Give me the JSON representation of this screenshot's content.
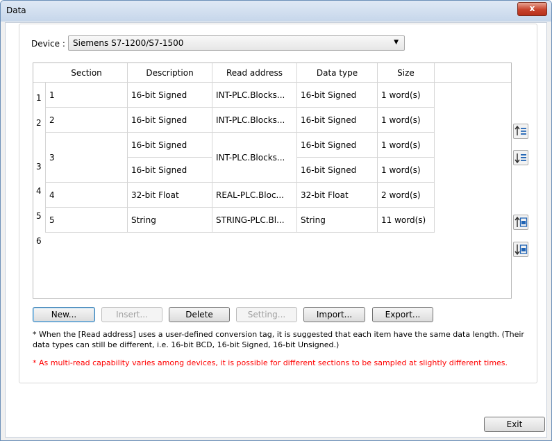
{
  "window": {
    "title": "Data",
    "close_label": "x"
  },
  "device": {
    "label": "Device :",
    "value": "Siemens S7-1200/S7-1500"
  },
  "table": {
    "headers": [
      "Section",
      "Description",
      "Read address",
      "Data type",
      "Size"
    ],
    "row_numbers": [
      "1",
      "2",
      "3",
      "4",
      "5",
      "6"
    ],
    "sections": [
      "1",
      "2",
      "3",
      "4",
      "5"
    ],
    "rows": [
      {
        "description": "16-bit Signed",
        "read_address": "INT-PLC.Blocks...",
        "data_type": "16-bit Signed",
        "size": "1 word(s)"
      },
      {
        "description": "16-bit Signed",
        "read_address": "INT-PLC.Blocks...",
        "data_type": "16-bit Signed",
        "size": "1 word(s)"
      },
      {
        "description": "16-bit Signed",
        "read_address": "INT-PLC.Blocks...",
        "data_type": "16-bit Signed",
        "size": "1 word(s)"
      },
      {
        "description": "16-bit Signed",
        "read_address": "",
        "data_type": "16-bit Signed",
        "size": "1 word(s)"
      },
      {
        "description": "32-bit Float",
        "read_address": "REAL-PLC.Bloc...",
        "data_type": "32-bit Float",
        "size": "2 word(s)"
      },
      {
        "description": "String",
        "read_address": "STRING-PLC.Bl...",
        "data_type": "String",
        "size": "11 word(s)"
      }
    ]
  },
  "buttons": {
    "new": "New...",
    "insert": "Insert...",
    "delete": "Delete",
    "setting": "Setting...",
    "import": "Import...",
    "export": "Export...",
    "exit": "Exit"
  },
  "notes": {
    "note1": "* When the [Read address] uses a user-defined conversion tag, it is suggested that each item have the same data length. (Their data types can still be different, i.e. 16-bit BCD, 16-bit Signed, 16-bit Unsigned.)",
    "note2": "* As multi-read capability varies among devices, it is possible for different sections to be sampled at slightly different times."
  },
  "side_icons": [
    "move-up-icon",
    "move-down-icon",
    "move-top-icon",
    "move-bottom-icon"
  ],
  "colors": {
    "warning_text": "#ff0000",
    "icon_blue": "#1f63b4",
    "close_red": "#c7432c"
  }
}
